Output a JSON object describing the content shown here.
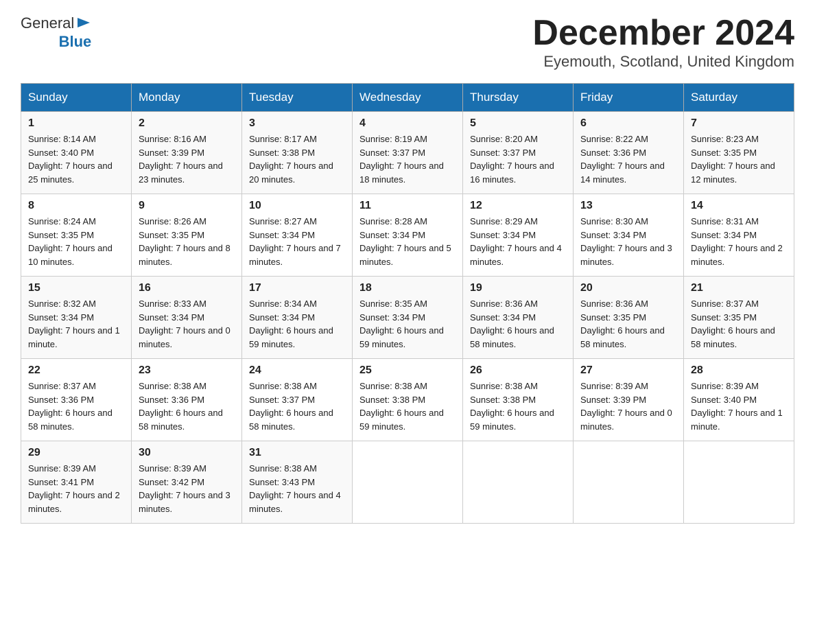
{
  "logo": {
    "text_general": "General",
    "text_blue": "Blue"
  },
  "title": "December 2024",
  "subtitle": "Eyemouth, Scotland, United Kingdom",
  "days_of_week": [
    "Sunday",
    "Monday",
    "Tuesday",
    "Wednesday",
    "Thursday",
    "Friday",
    "Saturday"
  ],
  "weeks": [
    [
      {
        "day": "1",
        "sunrise": "8:14 AM",
        "sunset": "3:40 PM",
        "daylight": "7 hours and 25 minutes."
      },
      {
        "day": "2",
        "sunrise": "8:16 AM",
        "sunset": "3:39 PM",
        "daylight": "7 hours and 23 minutes."
      },
      {
        "day": "3",
        "sunrise": "8:17 AM",
        "sunset": "3:38 PM",
        "daylight": "7 hours and 20 minutes."
      },
      {
        "day": "4",
        "sunrise": "8:19 AM",
        "sunset": "3:37 PM",
        "daylight": "7 hours and 18 minutes."
      },
      {
        "day": "5",
        "sunrise": "8:20 AM",
        "sunset": "3:37 PM",
        "daylight": "7 hours and 16 minutes."
      },
      {
        "day": "6",
        "sunrise": "8:22 AM",
        "sunset": "3:36 PM",
        "daylight": "7 hours and 14 minutes."
      },
      {
        "day": "7",
        "sunrise": "8:23 AM",
        "sunset": "3:35 PM",
        "daylight": "7 hours and 12 minutes."
      }
    ],
    [
      {
        "day": "8",
        "sunrise": "8:24 AM",
        "sunset": "3:35 PM",
        "daylight": "7 hours and 10 minutes."
      },
      {
        "day": "9",
        "sunrise": "8:26 AM",
        "sunset": "3:35 PM",
        "daylight": "7 hours and 8 minutes."
      },
      {
        "day": "10",
        "sunrise": "8:27 AM",
        "sunset": "3:34 PM",
        "daylight": "7 hours and 7 minutes."
      },
      {
        "day": "11",
        "sunrise": "8:28 AM",
        "sunset": "3:34 PM",
        "daylight": "7 hours and 5 minutes."
      },
      {
        "day": "12",
        "sunrise": "8:29 AM",
        "sunset": "3:34 PM",
        "daylight": "7 hours and 4 minutes."
      },
      {
        "day": "13",
        "sunrise": "8:30 AM",
        "sunset": "3:34 PM",
        "daylight": "7 hours and 3 minutes."
      },
      {
        "day": "14",
        "sunrise": "8:31 AM",
        "sunset": "3:34 PM",
        "daylight": "7 hours and 2 minutes."
      }
    ],
    [
      {
        "day": "15",
        "sunrise": "8:32 AM",
        "sunset": "3:34 PM",
        "daylight": "7 hours and 1 minute."
      },
      {
        "day": "16",
        "sunrise": "8:33 AM",
        "sunset": "3:34 PM",
        "daylight": "7 hours and 0 minutes."
      },
      {
        "day": "17",
        "sunrise": "8:34 AM",
        "sunset": "3:34 PM",
        "daylight": "6 hours and 59 minutes."
      },
      {
        "day": "18",
        "sunrise": "8:35 AM",
        "sunset": "3:34 PM",
        "daylight": "6 hours and 59 minutes."
      },
      {
        "day": "19",
        "sunrise": "8:36 AM",
        "sunset": "3:34 PM",
        "daylight": "6 hours and 58 minutes."
      },
      {
        "day": "20",
        "sunrise": "8:36 AM",
        "sunset": "3:35 PM",
        "daylight": "6 hours and 58 minutes."
      },
      {
        "day": "21",
        "sunrise": "8:37 AM",
        "sunset": "3:35 PM",
        "daylight": "6 hours and 58 minutes."
      }
    ],
    [
      {
        "day": "22",
        "sunrise": "8:37 AM",
        "sunset": "3:36 PM",
        "daylight": "6 hours and 58 minutes."
      },
      {
        "day": "23",
        "sunrise": "8:38 AM",
        "sunset": "3:36 PM",
        "daylight": "6 hours and 58 minutes."
      },
      {
        "day": "24",
        "sunrise": "8:38 AM",
        "sunset": "3:37 PM",
        "daylight": "6 hours and 58 minutes."
      },
      {
        "day": "25",
        "sunrise": "8:38 AM",
        "sunset": "3:38 PM",
        "daylight": "6 hours and 59 minutes."
      },
      {
        "day": "26",
        "sunrise": "8:38 AM",
        "sunset": "3:38 PM",
        "daylight": "6 hours and 59 minutes."
      },
      {
        "day": "27",
        "sunrise": "8:39 AM",
        "sunset": "3:39 PM",
        "daylight": "7 hours and 0 minutes."
      },
      {
        "day": "28",
        "sunrise": "8:39 AM",
        "sunset": "3:40 PM",
        "daylight": "7 hours and 1 minute."
      }
    ],
    [
      {
        "day": "29",
        "sunrise": "8:39 AM",
        "sunset": "3:41 PM",
        "daylight": "7 hours and 2 minutes."
      },
      {
        "day": "30",
        "sunrise": "8:39 AM",
        "sunset": "3:42 PM",
        "daylight": "7 hours and 3 minutes."
      },
      {
        "day": "31",
        "sunrise": "8:38 AM",
        "sunset": "3:43 PM",
        "daylight": "7 hours and 4 minutes."
      },
      null,
      null,
      null,
      null
    ]
  ]
}
